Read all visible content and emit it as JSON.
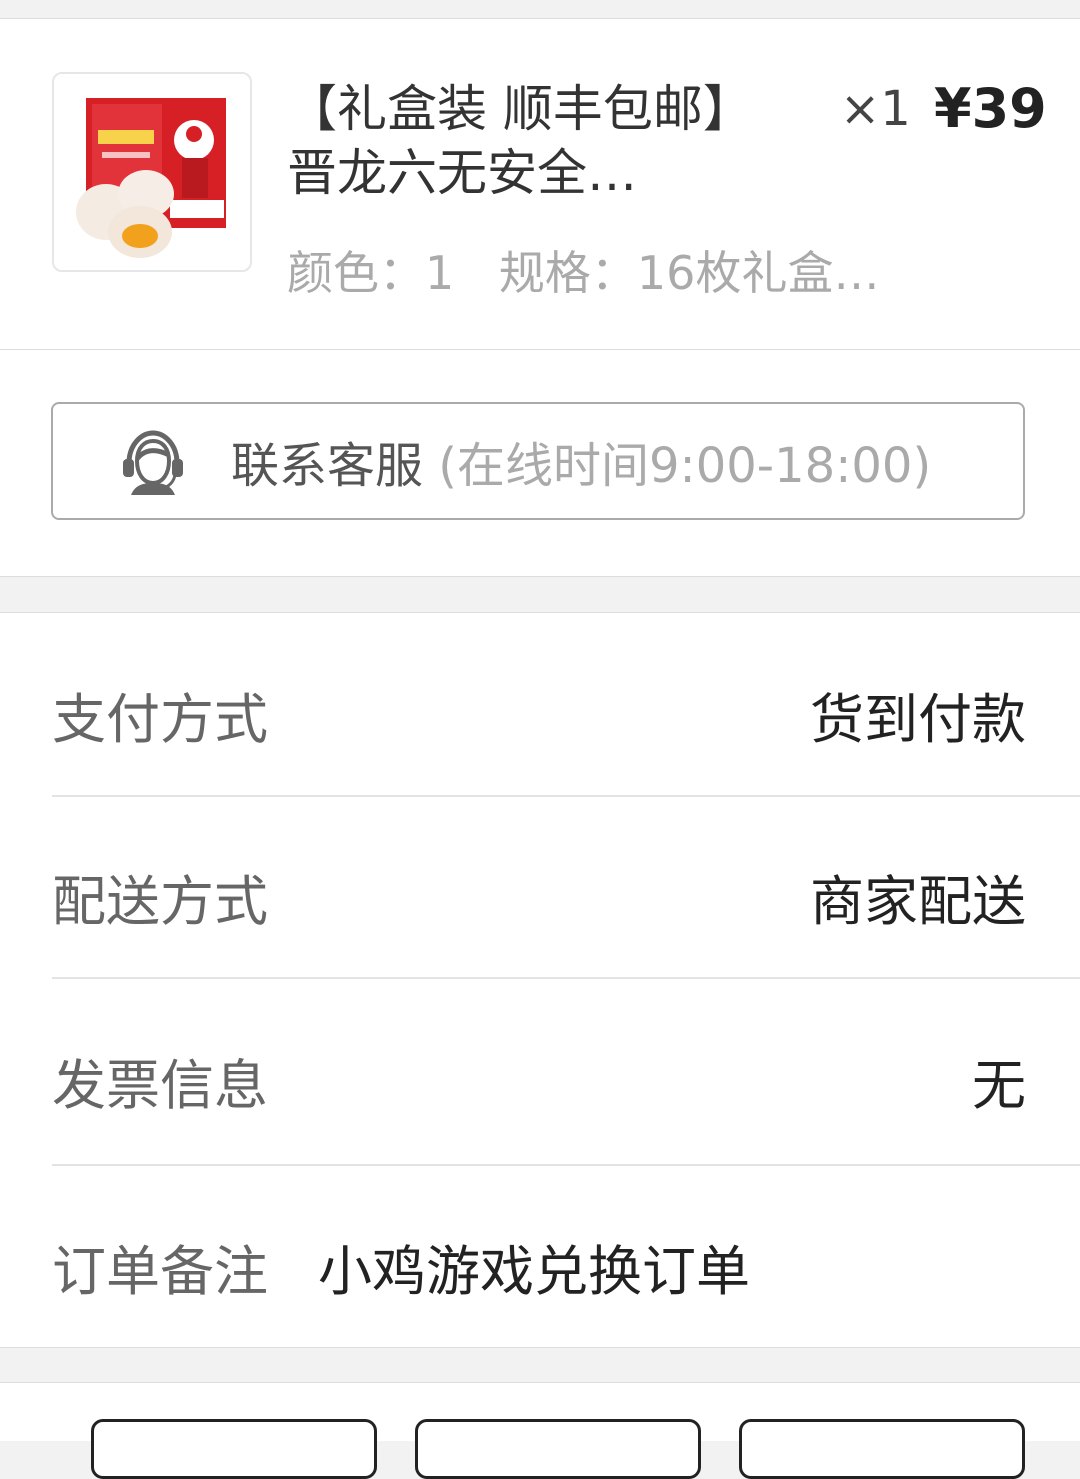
{
  "product": {
    "title": "【礼盒装 顺丰包邮】晋龙六无安全…",
    "quantity": "×1",
    "price": "¥39",
    "color_label": "颜色：",
    "color_value": "1",
    "spec_label": "规格：",
    "spec_value": "16枚礼盒…",
    "thumbnail_icon": "egg-gift-box-image"
  },
  "contact": {
    "label": "联系客服",
    "hours": "(在线时间9:00-18:00)",
    "icon": "customer-service-headset-icon"
  },
  "order_info": {
    "payment_label": "支付方式",
    "payment_value": "货到付款",
    "delivery_label": "配送方式",
    "delivery_value": "商家配送",
    "invoice_label": "发票信息",
    "invoice_value": "无",
    "note_label": "订单备注",
    "note_value": "小鸡游戏兑换订单"
  },
  "colors": {
    "accent_red": "#d71f26",
    "text_dark": "#222222",
    "text_gray": "#aaaaaa"
  }
}
